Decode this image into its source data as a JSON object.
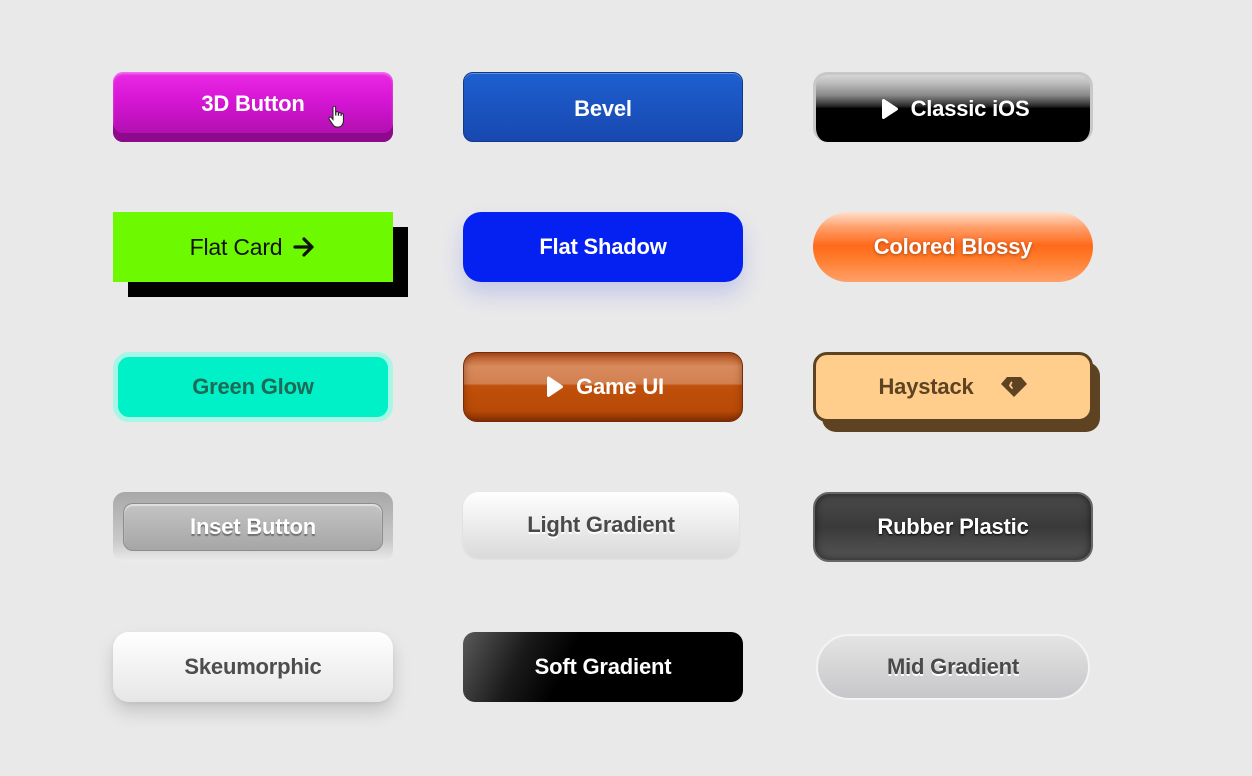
{
  "buttons": {
    "three_d": {
      "label": "3D Button",
      "color": "#d616d4"
    },
    "bevel": {
      "label": "Bevel",
      "color": "#1b53c0"
    },
    "classic_ios": {
      "label": "Classic iOS",
      "icon": "play-icon"
    },
    "flat_card": {
      "label": "Flat Card",
      "icon": "arrow-right-icon",
      "color": "#6dfa00"
    },
    "flat_shadow": {
      "label": "Flat Shadow",
      "color": "#0521f2"
    },
    "colored_blossy": {
      "label": "Colored Blossy",
      "color": "#ff6a1a"
    },
    "green_glow": {
      "label": "Green Glow",
      "color": "#00f0c8"
    },
    "game_ui": {
      "label": "Game UI",
      "icon": "play-icon",
      "color": "#c0500a"
    },
    "haystack": {
      "label": "Haystack",
      "icon": "diamond-icon",
      "color": "#ffce8c"
    },
    "inset_button": {
      "label": "Inset Button"
    },
    "light_gradient": {
      "label": "Light Gradient"
    },
    "rubber_plastic": {
      "label": "Rubber Plastic"
    },
    "skeumorphic": {
      "label": "Skeumorphic"
    },
    "soft_gradient": {
      "label": "Soft Gradient"
    },
    "mid_gradient": {
      "label": "Mid Gradient"
    }
  },
  "cursor": {
    "icon": "hand-pointer-icon"
  }
}
